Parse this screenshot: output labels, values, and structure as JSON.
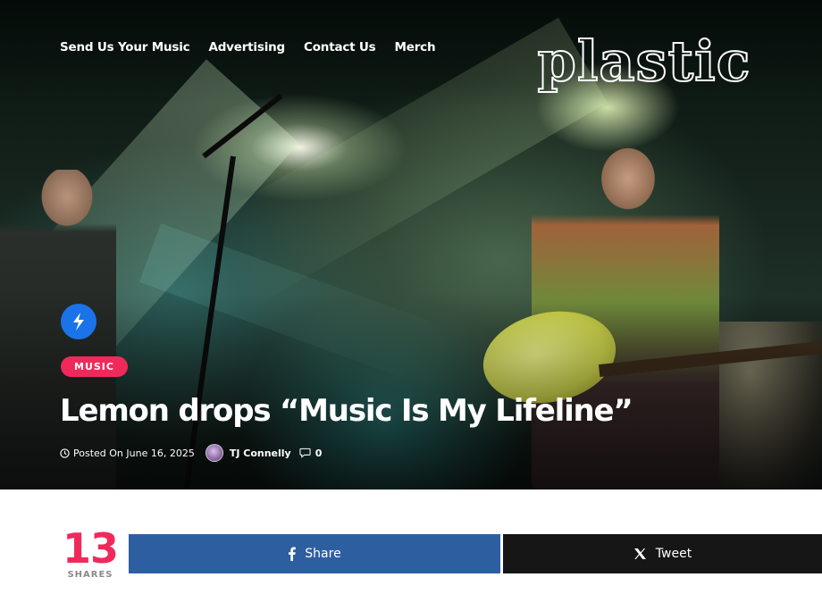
{
  "nav": {
    "items": [
      "Send Us Your Music",
      "Advertising",
      "Contact Us",
      "Merch"
    ]
  },
  "logo": {
    "text": "plastic"
  },
  "article": {
    "category": "MUSIC",
    "title": "Lemon drops “Music Is My Lifeline”",
    "date": "Posted On June 16, 2025",
    "author": "TJ Connelly",
    "comments": "0"
  },
  "shares": {
    "count": "13",
    "label": "SHARES"
  },
  "share_buttons": {
    "facebook": "Share",
    "twitter": "Tweet"
  },
  "colors": {
    "accent_pink": "#ef2a5b",
    "facebook_blue": "#2d5fa0",
    "twitter_black": "#161616",
    "bolt_badge_blue": "#1a73e8"
  },
  "icons": [
    "bolt-icon",
    "clock-icon",
    "comment-icon",
    "facebook-icon",
    "x-icon"
  ]
}
